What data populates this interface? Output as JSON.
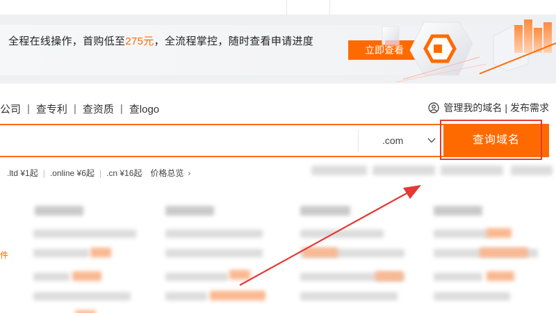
{
  "banner": {
    "text_before": "全程在线操作，首购低至",
    "price": "275元",
    "text_after": "，全流程掌控，随时查看申请进度",
    "button": "立即查看"
  },
  "tabs": [
    {
      "label": "公司"
    },
    {
      "label": "查专利"
    },
    {
      "label": "查资质"
    },
    {
      "label": "查logo"
    }
  ],
  "account": {
    "manage_domains": "管理我的域名",
    "publish_request": "发布需求"
  },
  "search": {
    "placeholder": "",
    "suffix": ".com",
    "button": "查询域名"
  },
  "prices": [
    {
      "label": ".ltd ¥1起"
    },
    {
      "label": ".online ¥6起"
    },
    {
      "label": ".cn ¥16起"
    }
  ],
  "price_overview": "价格总览",
  "left_fragment": "件",
  "colors": {
    "accent": "#ff6a00",
    "annotation": "#e53935"
  }
}
